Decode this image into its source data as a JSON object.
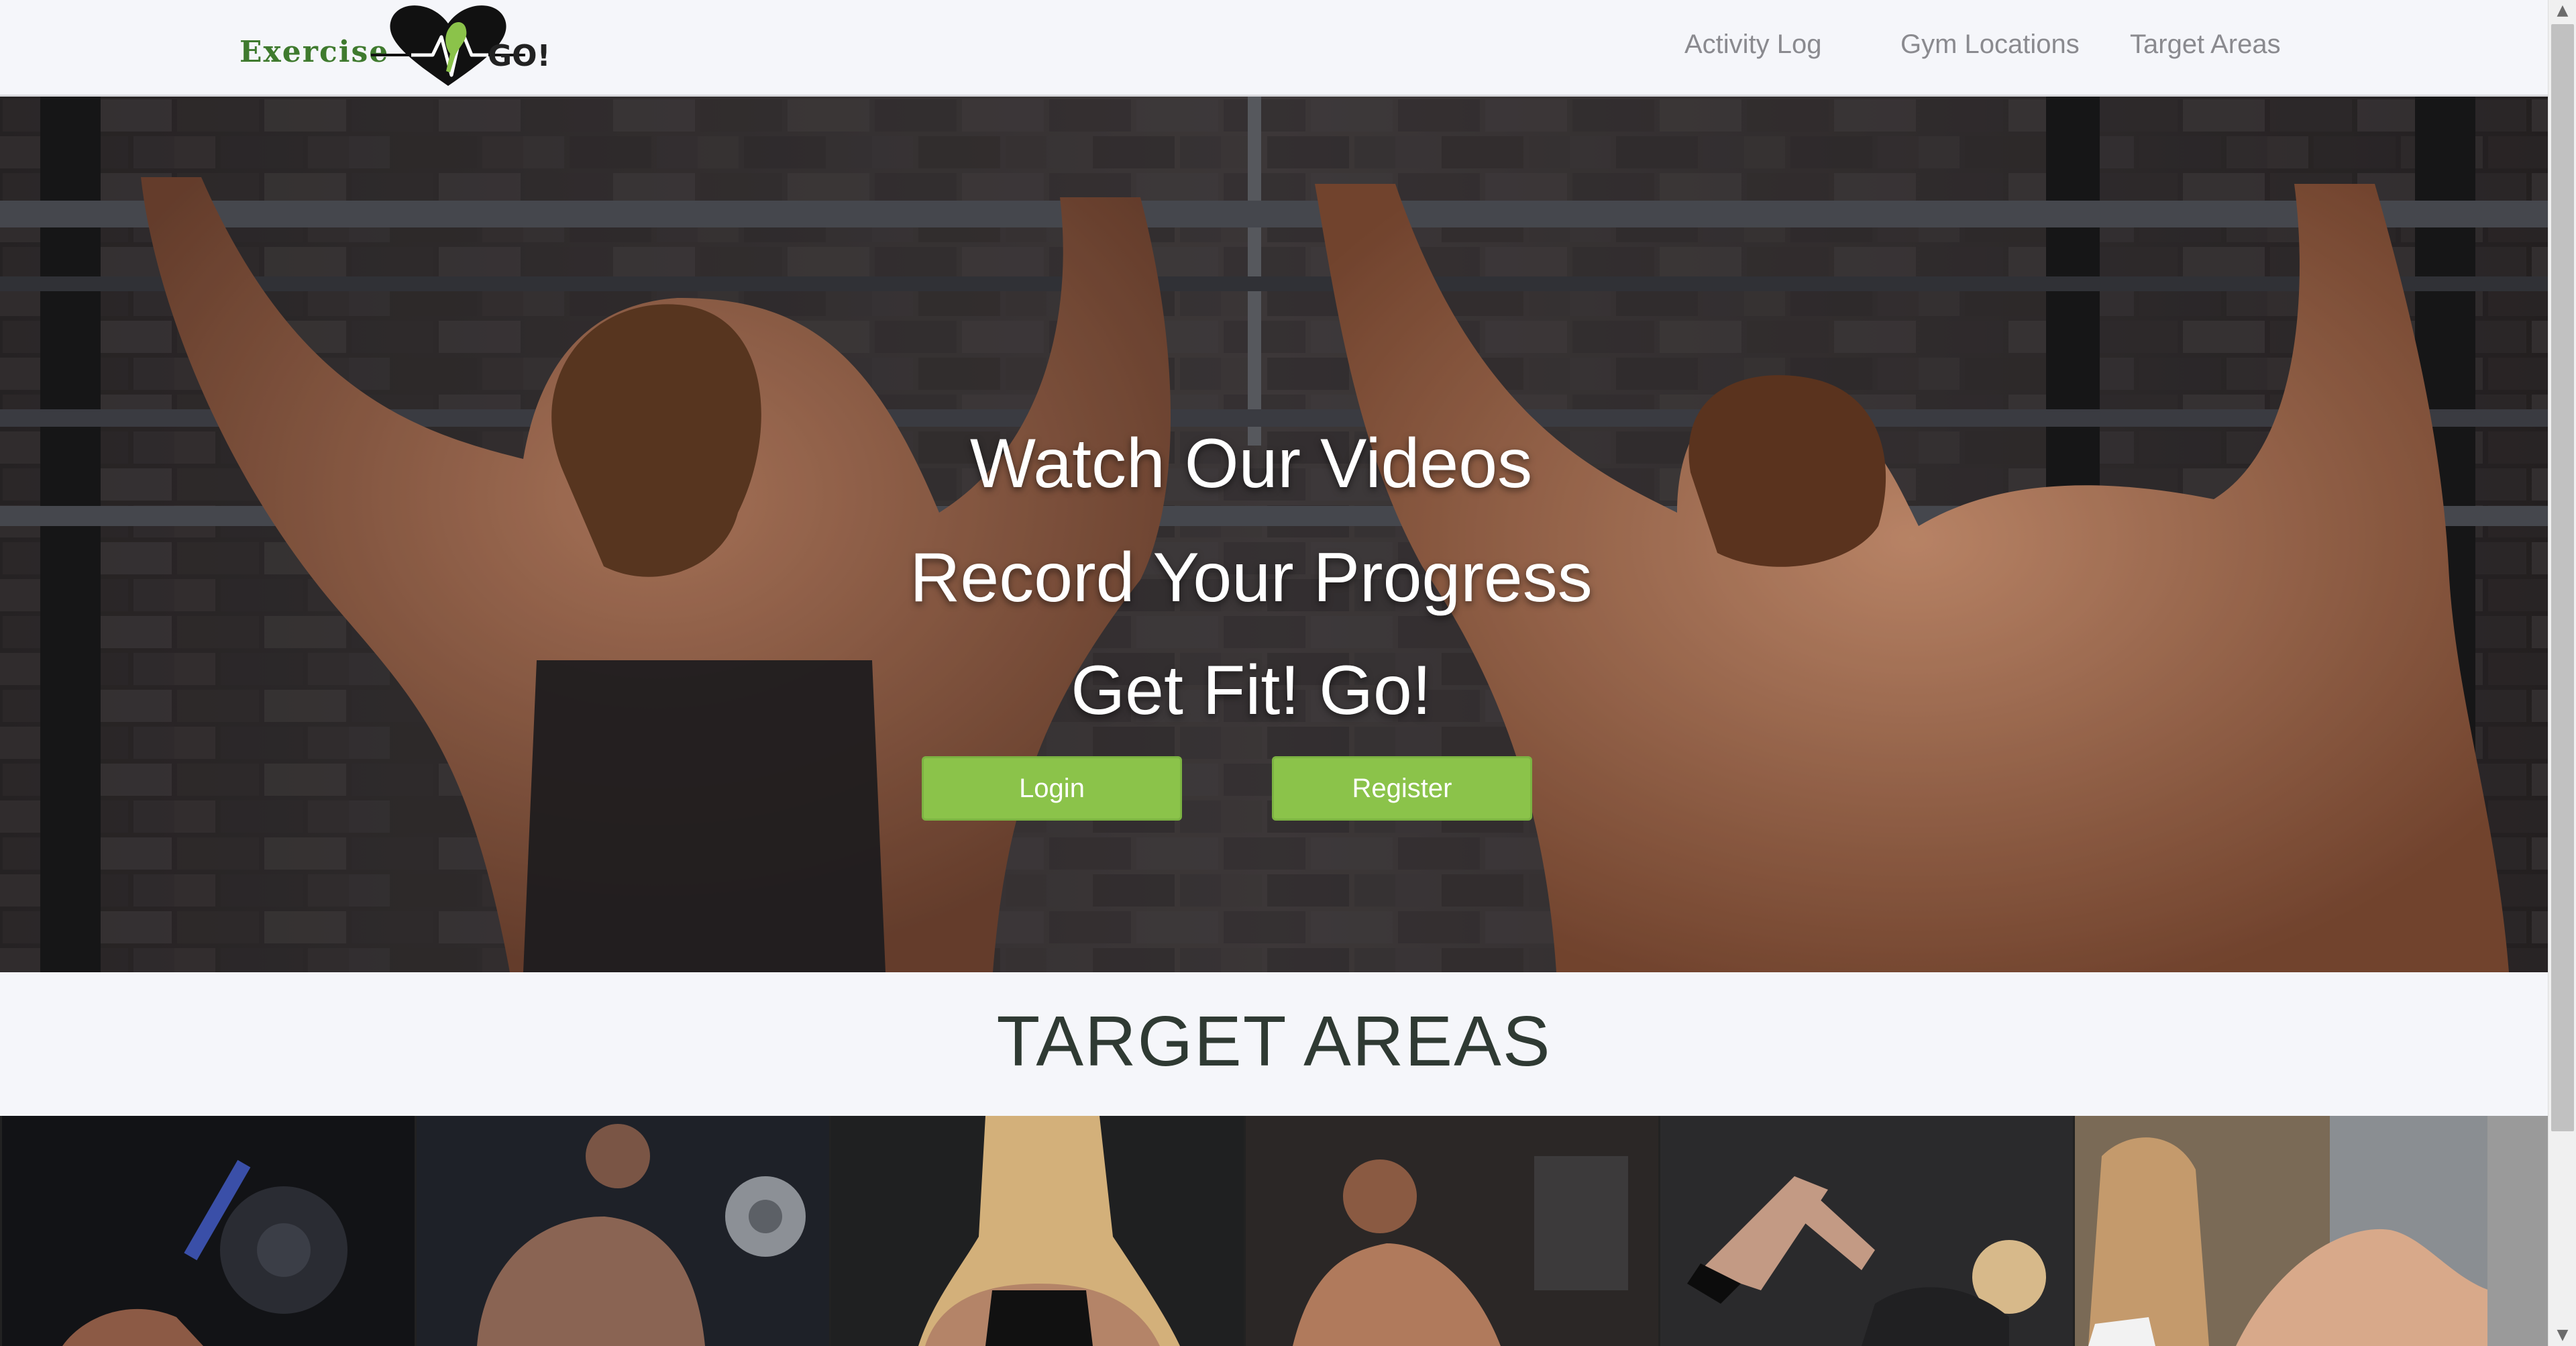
{
  "brand": {
    "word1": "Exercise",
    "word2": "GO!",
    "colors": {
      "green": "#3f7a2e",
      "accent": "#8bc34a",
      "heart": "#111111"
    }
  },
  "nav": {
    "items": [
      {
        "label": "Activity Log"
      },
      {
        "label": "Gym Locations"
      },
      {
        "label": "Target Areas"
      }
    ]
  },
  "hero": {
    "lines": [
      "Watch Our Videos",
      "Record Your Progress",
      "Get Fit! Go!"
    ],
    "login_label": "Login",
    "register_label": "Register"
  },
  "target_areas": {
    "title": "TARGET AREAS",
    "tiles": [
      {
        "icon": "legs-press-photo"
      },
      {
        "icon": "arms-dumbbell-photo"
      },
      {
        "icon": "back-photo"
      },
      {
        "icon": "chest-pushup-photo"
      },
      {
        "icon": "abs-crunch-photo"
      },
      {
        "icon": "stretch-photo"
      }
    ]
  },
  "scrollbar": {
    "up_icon": "scroll-up-arrow-icon",
    "down_icon": "scroll-down-arrow-icon"
  }
}
